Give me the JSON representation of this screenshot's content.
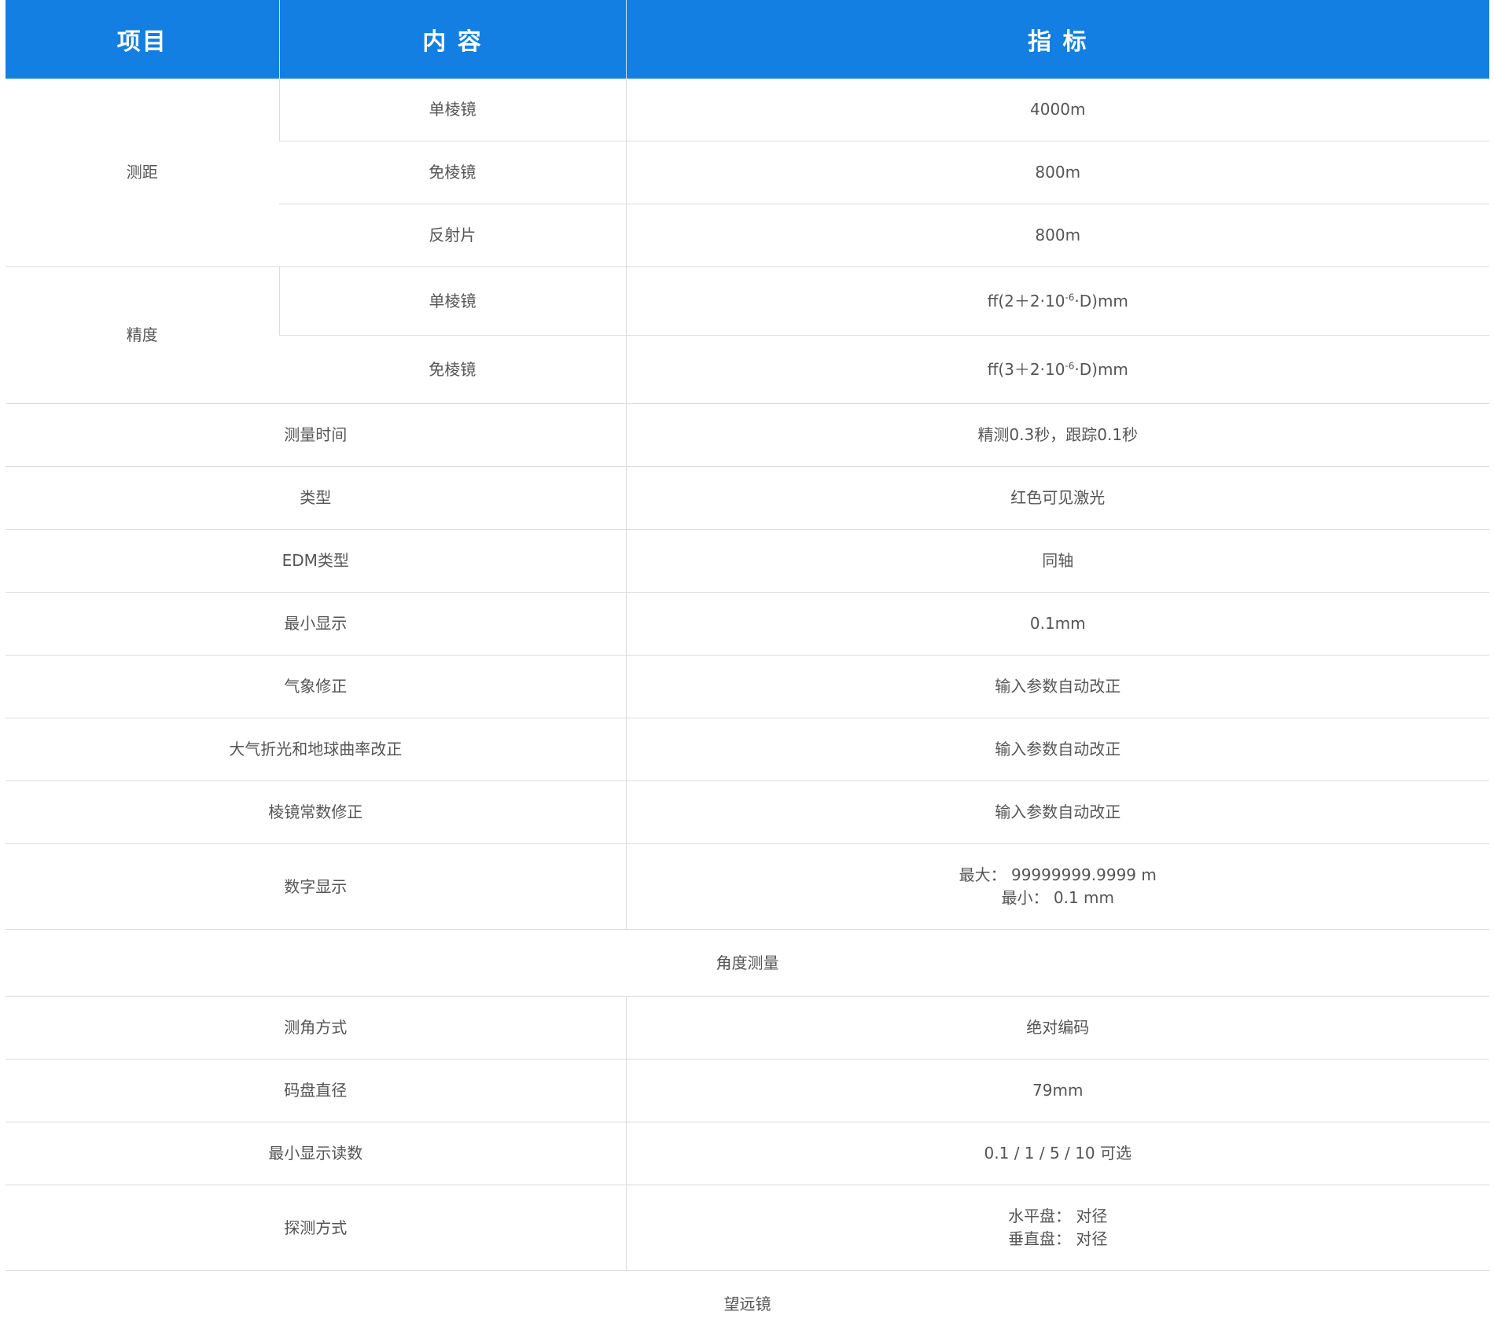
{
  "header": {
    "col_item": "项目",
    "col_content": "内 容",
    "col_index": "指 标"
  },
  "groups": [
    {
      "label": "测距",
      "rows": [
        {
          "content": "单棱镜",
          "value": "4000m"
        },
        {
          "content": "免棱镜",
          "value": "800m"
        },
        {
          "content": "反射片",
          "value": "800m"
        }
      ]
    },
    {
      "label": "精度",
      "rows": [
        {
          "content": "单棱镜",
          "value_pre": "ﬀ(2＋2·10",
          "value_sup": "-6",
          "value_post": "·D)mm"
        },
        {
          "content": "免棱镜",
          "value_pre": "ﬀ(3＋2·10",
          "value_sup": "-6",
          "value_post": "·D)mm"
        }
      ]
    }
  ],
  "rows": [
    {
      "label": "测量时间",
      "value": "精测0.3秒，跟踪0.1秒"
    },
    {
      "label": "类型",
      "value": "红色可见激光"
    },
    {
      "label": "EDM类型",
      "value": "同轴"
    },
    {
      "label": "最小显示",
      "value": "0.1mm"
    },
    {
      "label": "气象修正",
      "value": "输入参数自动改正"
    },
    {
      "label": "大气折光和地球曲率改正",
      "value": "输入参数自动改正"
    },
    {
      "label": "棱镜常数修正",
      "value": "输入参数自动改正"
    },
    {
      "label": "数字显示",
      "value_line1": "最大：  99999999.9999 m",
      "value_line2": "最小：  0.1 mm"
    }
  ],
  "section_angle": {
    "title": "角度测量",
    "rows": [
      {
        "label": "测角方式",
        "value": "绝对编码"
      },
      {
        "label": "码盘直径",
        "value": "79mm"
      },
      {
        "label": "最小显示读数",
        "value": "0.1 / 1 / 5 / 10  可选"
      },
      {
        "label": "探测方式",
        "value_line1": "水平盘：  对径",
        "value_line2": "垂直盘：  对径"
      }
    ]
  },
  "section_telescope": {
    "title": "望远镜"
  }
}
